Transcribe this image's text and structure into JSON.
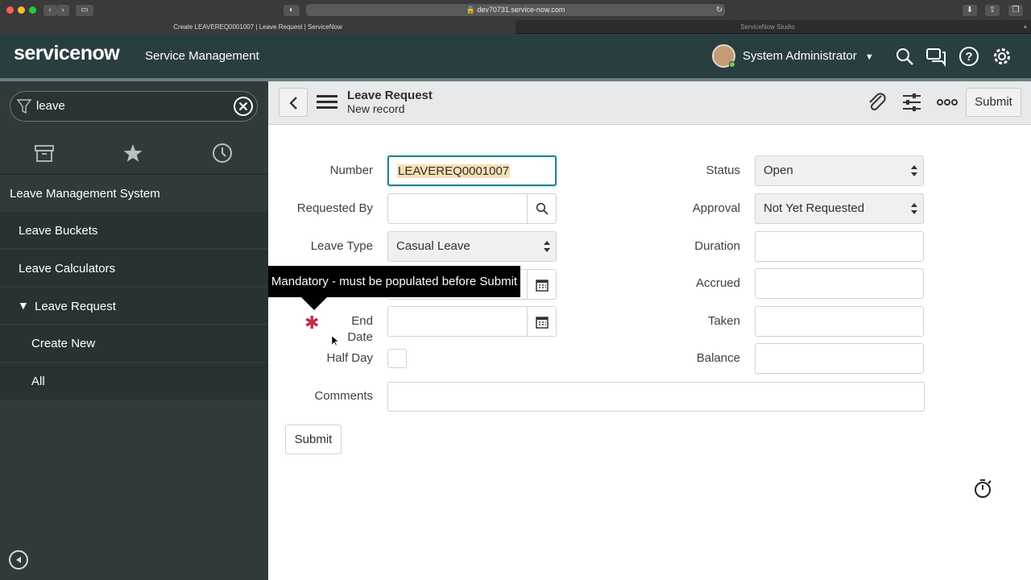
{
  "browser": {
    "url": "dev70731.service-now.com",
    "tab_active": "Create LEAVEREQ0001007 | Leave Request | ServiceNow",
    "tab_other": "ServiceNow Studio"
  },
  "header": {
    "logo": "servicenow",
    "product": "Service Management",
    "user": "System Administrator"
  },
  "sidebar": {
    "filter_value": "leave",
    "app_title": "Leave Management System",
    "items": [
      "Leave Buckets",
      "Leave Calculators",
      "Leave Request",
      "Create New",
      "All"
    ]
  },
  "form": {
    "title": "Leave Request",
    "subtitle": "New record",
    "submit_label": "Submit",
    "number_label": "Number",
    "number_value": "LEAVEREQ0001007",
    "requested_by_label": "Requested By",
    "requested_by_value": "",
    "leave_type_label": "Leave Type",
    "leave_type_value": "Casual Leave",
    "end_date_label": "End Date",
    "half_day_label": "Half Day",
    "comments_label": "Comments",
    "status_label": "Status",
    "status_value": "Open",
    "approval_label": "Approval",
    "approval_value": "Not Yet Requested",
    "duration_label": "Duration",
    "accrued_label": "Accrued",
    "taken_label": "Taken",
    "balance_label": "Balance",
    "tooltip": "Mandatory - must be populated before Submit",
    "bottom_submit_label": "Submit"
  },
  "colors": {
    "header": "#293e40",
    "sidebar": "#303a3a",
    "focus": "#20818b",
    "mandatory": "#c02f4a"
  }
}
